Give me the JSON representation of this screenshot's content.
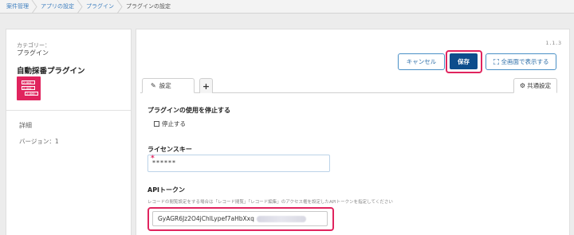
{
  "breadcrumb": {
    "items": [
      "案件管理",
      "アプリの設定",
      "プラグイン",
      "プラグインの設定"
    ]
  },
  "left": {
    "category_label": "カテゴリー：",
    "category_value": "プラグイン",
    "plugin_name": "自動採番プラグイン",
    "icon_lines": [
      "2-001",
      "2-002",
      "2-003"
    ],
    "detail_label": "詳細",
    "version_label": "バージョン：1"
  },
  "main": {
    "version": "1.1.3",
    "buttons": {
      "cancel": "キャンセル",
      "save": "保存",
      "fullscreen": "全画面で表示する"
    },
    "tabs": {
      "settings": "設定",
      "add": "+",
      "common": "共通設定"
    },
    "stop_section": {
      "title": "プラグインの使用を停止する",
      "checkbox_label": "停止する"
    },
    "license_section": {
      "title": "ライセンスキー",
      "required_mark": "*",
      "value": "******"
    },
    "api_section": {
      "title": "APIトークン",
      "description": "レコードの閲覧設定をする場合は「レコード閲覧」「レコード編集」のアクセス権を設定したAPIトークンを指定してください",
      "value": "GyAGR6Jz2O4jChlLypef7aHbXxq"
    }
  },
  "colors": {
    "accent": "#0d4d8c",
    "highlight": "#e0245e",
    "link": "#3f7fbf"
  }
}
